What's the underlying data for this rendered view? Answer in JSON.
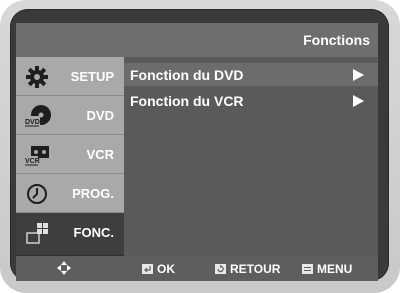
{
  "header": {
    "title": "Fonctions"
  },
  "sidebar": {
    "items": [
      {
        "label": "SETUP",
        "icon": "gear-icon",
        "active": false
      },
      {
        "label": "DVD",
        "icon": "dvd-disc-icon",
        "active": false
      },
      {
        "label": "VCR",
        "icon": "vcr-cassette-icon",
        "active": false
      },
      {
        "label": "PROG.",
        "icon": "clock-icon",
        "active": false
      },
      {
        "label": "FONC.",
        "icon": "function-blocks-icon",
        "active": true
      }
    ]
  },
  "menu": {
    "items": [
      {
        "label": "Fonction du DVD",
        "selected": true
      },
      {
        "label": "Fonction du VCR",
        "selected": false
      }
    ]
  },
  "footer": {
    "nav_icon": "directional-pad-icon",
    "ok_label": "OK",
    "ok_icon": "enter-icon",
    "retour_label": "RETOUR",
    "retour_icon": "return-icon",
    "menu_label": "MENU",
    "menu_icon": "menu-icon"
  },
  "colors": {
    "bezel": "#d0d0d0",
    "header": "#6e6e6e",
    "content": "#5a5a5a",
    "sidebar_inactive": "#a9a9a9",
    "sidebar_active": "#3e3e3e"
  }
}
